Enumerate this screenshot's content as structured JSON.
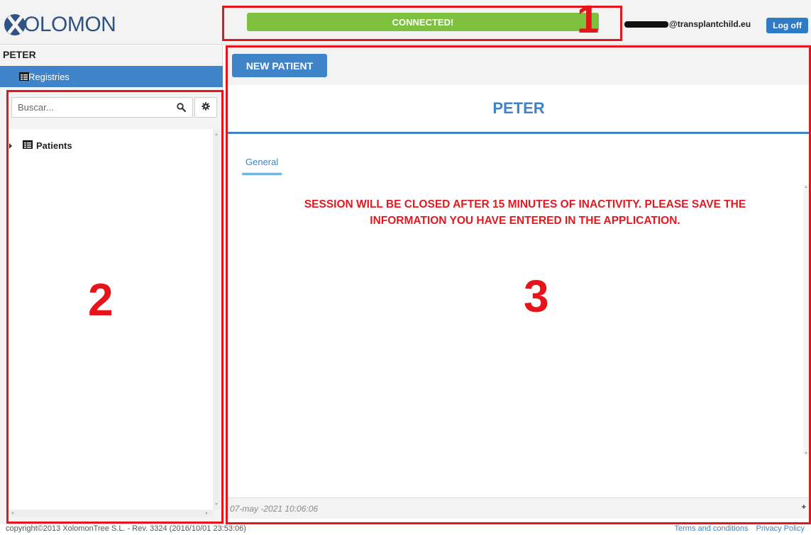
{
  "header": {
    "logo_text": "OLOMON",
    "status": "CONNECTED!",
    "user_email": "@transplantchild.eu",
    "logoff_label": "Log off"
  },
  "sidebar": {
    "title": "PETER",
    "nav_item": "Registries",
    "search_placeholder": "Buscar...",
    "tree": [
      {
        "label": "Patients"
      }
    ]
  },
  "main": {
    "new_patient_label": "NEW PATIENT",
    "page_title": "PETER",
    "tabs": [
      {
        "label": "General"
      }
    ],
    "warning_line1": "SESSION WILL BE CLOSED AFTER 15 MINUTES OF INACTIVITY. PLEASE SAVE THE",
    "warning_line2": "INFORMATION YOU HAVE ENTERED IN THE APPLICATION.",
    "timestamp": "07-may -2021 10:06:06",
    "footer_plus": "+"
  },
  "footer": {
    "copyright": "copyright©2013 XolomonTree S.L. - Rev. 3324 (2016/10/01 23:53:06)",
    "terms_label": "Terms and conditions",
    "privacy_label": "Privacy Policy"
  },
  "annotations": [
    {
      "number": "1"
    },
    {
      "number": "2"
    },
    {
      "number": "3"
    }
  ],
  "colors": {
    "brand_blue": "#3f83c8",
    "logo_navy": "#2f5382",
    "connected_green": "#7ec13f",
    "annotation_red": "#e8141c",
    "warning_red": "#e5181f"
  },
  "icons": [
    "logo-x-icon",
    "table-icon",
    "search-icon",
    "gear-icon",
    "caret-right-icon"
  ]
}
